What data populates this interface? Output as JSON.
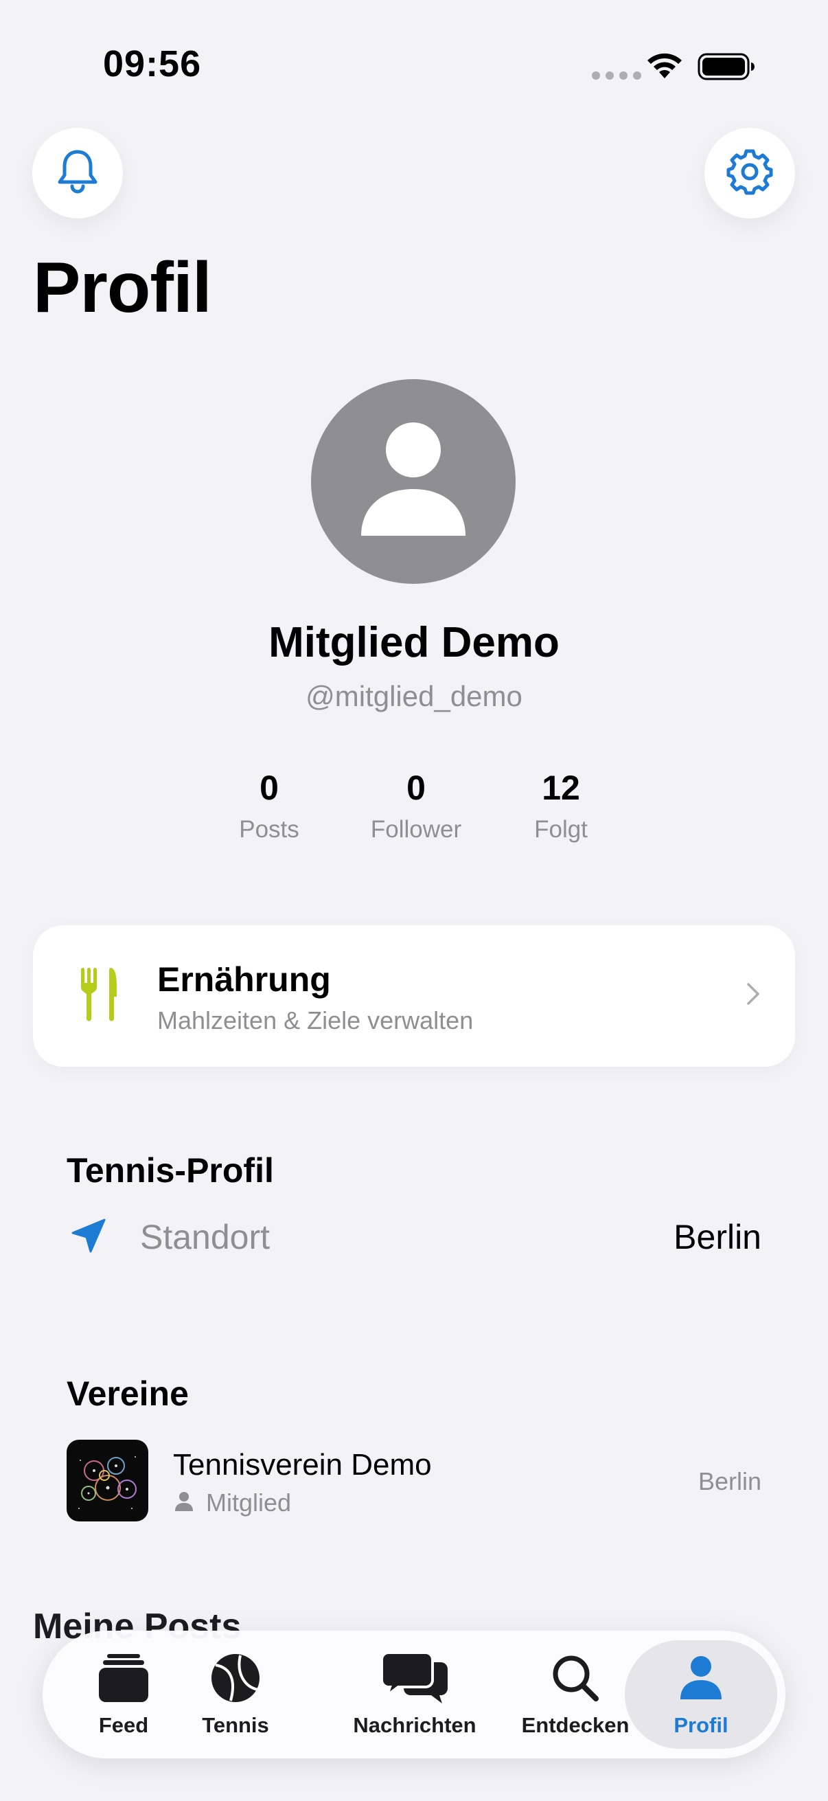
{
  "status_bar": {
    "time": "09:56"
  },
  "header": {
    "title": "Profil"
  },
  "profile": {
    "name": "Mitglied Demo",
    "handle": "@mitglied_demo",
    "stats": [
      {
        "value": "0",
        "label": "Posts"
      },
      {
        "value": "0",
        "label": "Follower"
      },
      {
        "value": "12",
        "label": "Folgt"
      }
    ]
  },
  "nutrition": {
    "title": "Ernährung",
    "subtitle": "Mahlzeiten & Ziele verwalten",
    "icon": "fork-knife-icon",
    "icon_color": "#B5CC18"
  },
  "tennis_profile": {
    "title": "Tennis-Profil",
    "location_label": "Standort",
    "location_value": "Berlin"
  },
  "clubs": {
    "title": "Vereine",
    "items": [
      {
        "name": "Tennisverein Demo",
        "role": "Mitglied",
        "city": "Berlin"
      }
    ]
  },
  "posts_section": {
    "title": "Meine Posts"
  },
  "tab_bar": {
    "items": [
      {
        "label": "Feed",
        "icon": "feed-icon"
      },
      {
        "label": "Tennis",
        "icon": "tennis-ball-icon"
      },
      {
        "label": "Nachrichten",
        "icon": "messages-icon"
      },
      {
        "label": "Entdecken",
        "icon": "magnifier-icon"
      },
      {
        "label": "Profil",
        "icon": "person-icon",
        "selected": true
      }
    ]
  },
  "colors": {
    "accent": "#1E7BD4",
    "background": "#F2F2F7",
    "secondary_text": "#8E8E93"
  }
}
